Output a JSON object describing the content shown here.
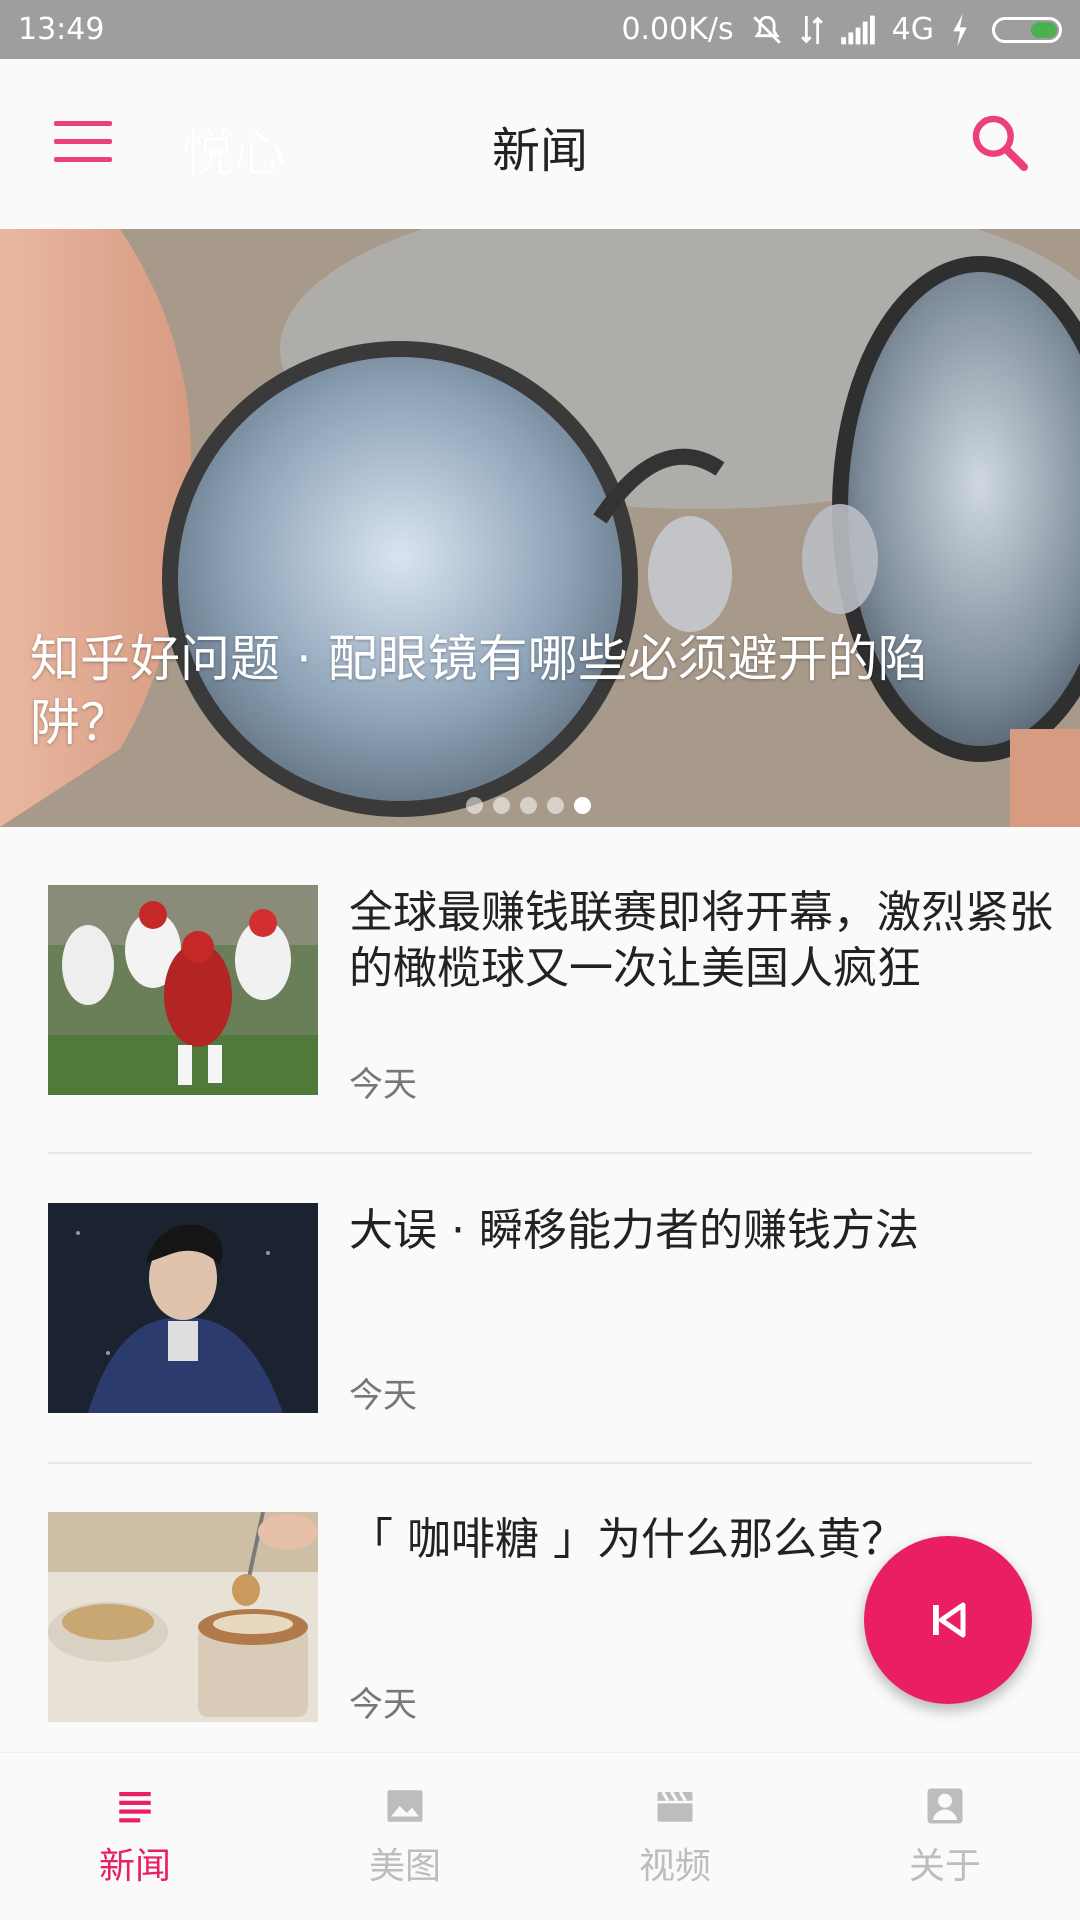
{
  "status_bar": {
    "time": "13:49",
    "network_speed": "0.00K/s",
    "network_type": "4G",
    "icons": [
      "mute-icon",
      "data-arrows-icon",
      "signal-icon",
      "charging-icon",
      "battery-icon"
    ]
  },
  "app_bar": {
    "app_name": "悦心",
    "title": "新闻",
    "menu_icon": "hamburger-icon",
    "search_icon": "search-icon"
  },
  "banner": {
    "caption": "知乎好问题 · 配眼镜有哪些必须避开的陷阱？",
    "page_count": 5,
    "active_index": 4
  },
  "news": [
    {
      "title": "全球最赚钱联赛即将开幕，激烈紧张的橄榄球又一次让美国人疯狂",
      "date": "今天",
      "thumb": "football-image"
    },
    {
      "title": "大误 · 瞬移能力者的赚钱方法",
      "date": "今天",
      "thumb": "man-portrait-image"
    },
    {
      "title": "「 咖啡糖 」为什么那么黄？",
      "date": "今天",
      "thumb": "coffee-sugar-image"
    }
  ],
  "fab": {
    "icon": "skip-previous-icon"
  },
  "bottom_nav": [
    {
      "label": "新闻",
      "icon": "news-list-icon",
      "active": true
    },
    {
      "label": "美图",
      "icon": "image-icon",
      "active": false
    },
    {
      "label": "视频",
      "icon": "video-clapper-icon",
      "active": false
    },
    {
      "label": "关于",
      "icon": "profile-icon",
      "active": false
    }
  ],
  "colors": {
    "accent": "#e91e63",
    "menu_accent": "#ec407a",
    "status_bar": "#9e9e9e",
    "inactive_nav": "#bdbdbd"
  }
}
